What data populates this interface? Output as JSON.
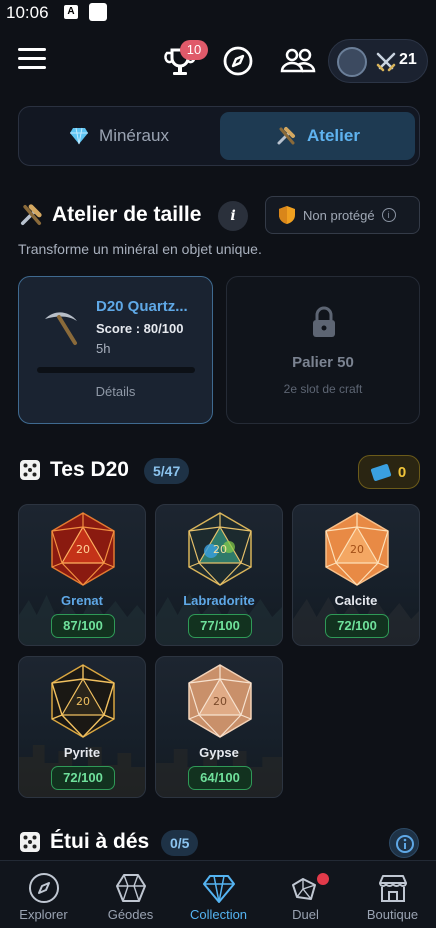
{
  "status_bar": {
    "time": "10:06",
    "icon_a": "A"
  },
  "header": {
    "menu_icon": "hamburger-icon",
    "trophy_badge": "10",
    "wallet_count": "21"
  },
  "tabs": [
    {
      "label": "Minéraux",
      "icon": "diamond-icon",
      "active": false
    },
    {
      "label": "Atelier",
      "icon": "tools-icon",
      "active": true
    }
  ],
  "atelier": {
    "title": "Atelier de taille",
    "info": "i",
    "protection": "Non protégé",
    "subtitle": "Transforme un minéral en objet unique.",
    "craft": {
      "name": "D20 Quartz...",
      "score": "Score : 80/100",
      "time": "5h",
      "progress": 0.0,
      "details": "Détails"
    },
    "locked": {
      "title": "Palier 50",
      "subtitle": "2e slot de craft"
    }
  },
  "d20": {
    "title": "Tes D20",
    "count": "5/47",
    "tickets": "0",
    "items": [
      {
        "name": "Grenat",
        "score": "87/100",
        "name_color": "#5fa8e6"
      },
      {
        "name": "Labradorite",
        "score": "77/100",
        "name_color": "#5fa8e6"
      },
      {
        "name": "Calcite",
        "score": "72/100",
        "name_color": "#e6e9ef"
      },
      {
        "name": "Pyrite",
        "score": "72/100",
        "name_color": "#e6e9ef"
      },
      {
        "name": "Gypse",
        "score": "64/100",
        "name_color": "#e6e9ef"
      }
    ]
  },
  "etui": {
    "title": "Étui à dés",
    "count": "0/5"
  },
  "bottom_nav": [
    {
      "label": "Explorer",
      "icon": "compass-icon",
      "active": false
    },
    {
      "label": "Géodes",
      "icon": "geode-icon",
      "active": false
    },
    {
      "label": "Collection",
      "icon": "gem-icon",
      "active": true
    },
    {
      "label": "Duel",
      "icon": "dice-icon",
      "active": false
    },
    {
      "label": "Boutique",
      "icon": "shop-icon",
      "active": false
    }
  ],
  "colors": {
    "accent": "#55b4f2",
    "score_green": "#6fe09b",
    "badge_red": "#e05a6a",
    "gold": "#f0c43a"
  }
}
